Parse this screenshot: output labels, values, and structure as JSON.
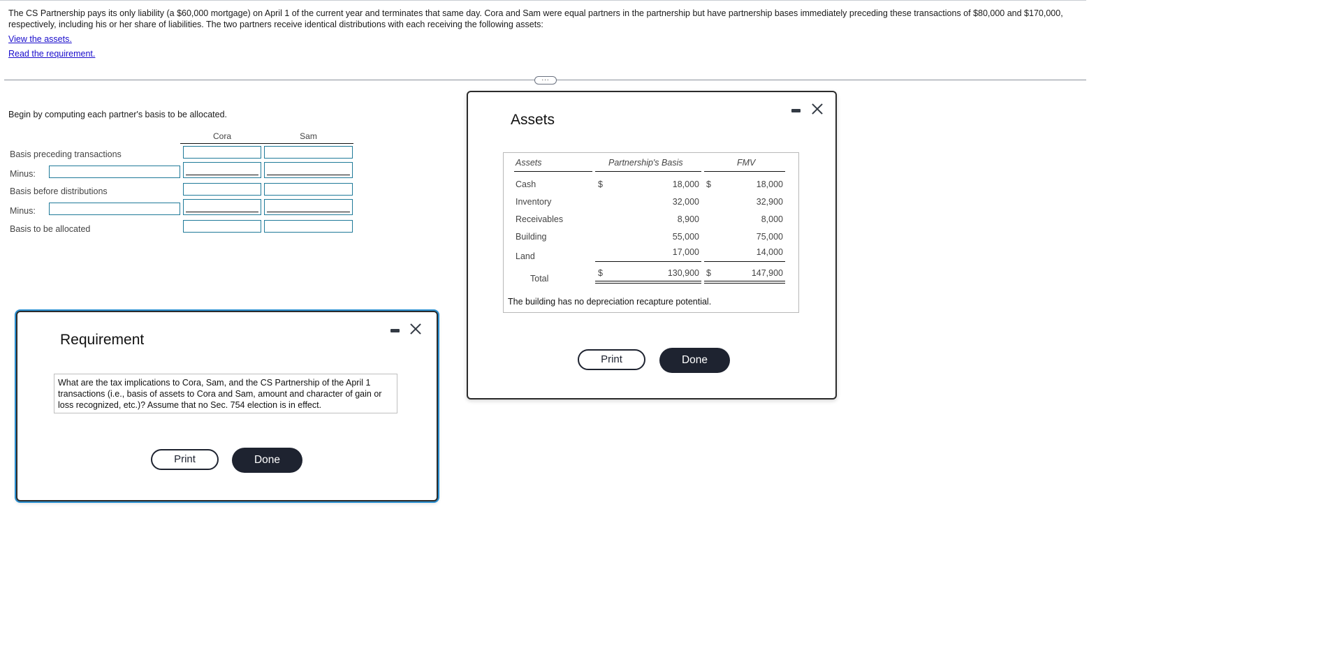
{
  "problem": {
    "text": "The CS Partnership pays its only liability (a $60,000 mortgage) on April 1 of the current year and terminates that same day. Cora and Sam were equal partners in the partnership but have partnership bases immediately preceding these transactions of $80,000 and $170,000, respectively, including his or her share of liabilities. The two partners receive identical distributions with each receiving the following assets:",
    "links": {
      "view_assets": "View the assets.",
      "read_requirement": "Read the requirement."
    },
    "expand_handle": "..."
  },
  "worksheet": {
    "instruction": "Begin by computing each partner's basis to be allocated.",
    "columns": [
      "Cora",
      "Sam"
    ],
    "rows": [
      {
        "label": "Basis preceding transactions",
        "has_label_input": false,
        "underline": false,
        "label_value": "",
        "cora": "",
        "sam": ""
      },
      {
        "label": "Minus:",
        "has_label_input": true,
        "underline": true,
        "label_value": "",
        "cora": "",
        "sam": ""
      },
      {
        "label": "Basis before distributions",
        "has_label_input": false,
        "underline": false,
        "label_value": "",
        "cora": "",
        "sam": ""
      },
      {
        "label": "Minus:",
        "has_label_input": true,
        "underline": true,
        "label_value": "",
        "cora": "",
        "sam": ""
      },
      {
        "label": "Basis to be allocated",
        "has_label_input": false,
        "underline": false,
        "label_value": "",
        "cora": "",
        "sam": ""
      }
    ]
  },
  "assets_dialog": {
    "title": "Assets",
    "minimize_icon": "minimize-icon",
    "close_icon": "close-icon",
    "headers": [
      "Assets",
      "Partnership's Basis",
      "FMV"
    ],
    "rows": [
      {
        "asset": "Cash",
        "basis_symbol": "$",
        "basis": "18,000",
        "fmv_symbol": "$",
        "fmv": "18,000"
      },
      {
        "asset": "Inventory",
        "basis_symbol": "",
        "basis": "32,000",
        "fmv_symbol": "",
        "fmv": "32,900"
      },
      {
        "asset": "Receivables",
        "basis_symbol": "",
        "basis": "8,900",
        "fmv_symbol": "",
        "fmv": "8,000"
      },
      {
        "asset": "Building",
        "basis_symbol": "",
        "basis": "55,000",
        "fmv_symbol": "",
        "fmv": "75,000"
      },
      {
        "asset": "Land",
        "basis_symbol": "",
        "basis": "17,000",
        "fmv_symbol": "",
        "fmv": "14,000"
      }
    ],
    "total": {
      "label": "Total",
      "basis_symbol": "$",
      "basis": "130,900",
      "fmv_symbol": "$",
      "fmv": "147,900"
    },
    "note": "The building has no depreciation recapture potential.",
    "print_label": "Print",
    "done_label": "Done"
  },
  "requirement_dialog": {
    "title": "Requirement",
    "minimize_icon": "minimize-icon",
    "close_icon": "close-icon",
    "text": "What are the tax implications to Cora, Sam, and the CS Partnership of the April 1 transactions (i.e., basis of assets to Cora and Sam, amount and character of gain or loss recognized, etc.)? Assume that no Sec. 754 election is in effect.",
    "print_label": "Print",
    "done_label": "Done"
  }
}
